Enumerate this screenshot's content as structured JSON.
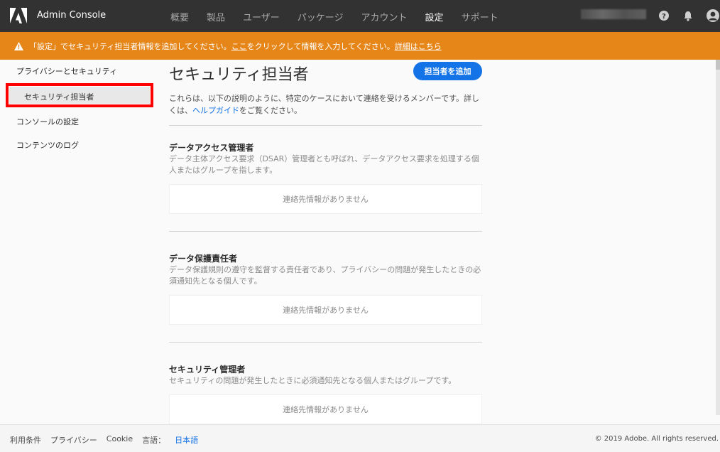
{
  "app": {
    "title": "Admin Console"
  },
  "nav": {
    "items": [
      "概要",
      "製品",
      "ユーザー",
      "パッケージ",
      "アカウント",
      "設定",
      "サポート"
    ],
    "active_index": 5
  },
  "banner": {
    "prefix": "「設定」でセキュリティ担当者情報を追加してください。",
    "link1": "ここ",
    "middle": "をクリックして情報を入力してください。",
    "link2": "詳細はこちら"
  },
  "sidebar": {
    "group_label": "プライバシーとセキュリティ",
    "items": [
      "セキュリティ担当者",
      "コンソールの設定",
      "コンテンツのログ"
    ]
  },
  "main": {
    "title": "セキュリティ担当者",
    "add_button": "担当者を追加",
    "intro_before": "これらは、以下の説明のように、特定のケースにおいて連絡を受けるメンバーです。詳しくは、",
    "intro_link": "ヘルプガイド",
    "intro_after": "をご覧ください。",
    "sections": [
      {
        "title": "データアクセス管理者",
        "desc": "データ主体アクセス要求（DSAR）管理者とも呼ばれ、データアクセス要求を処理する個人またはグループを指します。",
        "empty": "連絡先情報がありません"
      },
      {
        "title": "データ保護責任者",
        "desc": "データ保護規則の遵守を監督する責任者であり、プライバシーの問題が発生したときの必須通知先となる個人です。",
        "empty": "連絡先情報がありません"
      },
      {
        "title": "セキュリティ管理者",
        "desc": "セキュリティの問題が発生したときに必須通知先となる個人またはグループです。",
        "empty": "連絡先情報がありません"
      }
    ]
  },
  "footer": {
    "terms": "利用条件",
    "privacy": "プライバシー",
    "cookie": "Cookie",
    "language_label": "言語：",
    "language_value": "日本語",
    "copyright": "© 2019 Adobe. All rights reserved."
  },
  "colors": {
    "topbar": "#323232",
    "banner": "#e68619",
    "accent": "#1473e6",
    "highlight_border": "#ff0000"
  },
  "icons": [
    "adobe-logo-icon",
    "help-icon",
    "bell-icon",
    "avatar-icon",
    "warning-icon"
  ]
}
